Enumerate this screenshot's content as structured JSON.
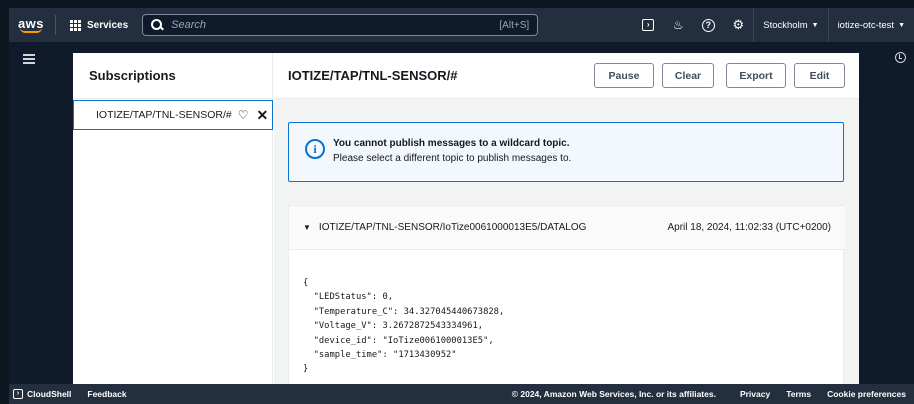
{
  "topnav": {
    "logo_text": "aws",
    "services_label": "Services",
    "search_placeholder": "Search",
    "search_shortcut": "[Alt+S]",
    "region": "Stockholm",
    "account": "iotize-otc-test"
  },
  "subscriptions": {
    "title": "Subscriptions",
    "items": [
      {
        "topic": "IOTIZE/TAP/TNL-SENSOR/#"
      }
    ]
  },
  "topic_panel": {
    "title": "IOTIZE/TAP/TNL-SENSOR/#",
    "buttons": {
      "pause": "Pause",
      "clear": "Clear",
      "export": "Export",
      "edit": "Edit"
    }
  },
  "alert": {
    "title": "You cannot publish messages to a wildcard topic.",
    "body": "Please select a different topic to publish messages to."
  },
  "message": {
    "topic": "IOTIZE/TAP/TNL-SENSOR/IoTize0061000013E5/DATALOG",
    "timestamp": "April 18, 2024, 11:02:33 (UTC+0200)",
    "payload_lines": [
      "{",
      "  \"LEDStatus\": 0,",
      "  \"Temperature_C\": 34.327045440673828,",
      "  \"Voltage_V\": 3.2672872543334961,",
      "  \"device_id\": \"IoTize0061000013E5\",",
      "  \"sample_time\": \"1713430952\"",
      "}"
    ]
  },
  "footer": {
    "cloudshell": "CloudShell",
    "feedback": "Feedback",
    "copyright": "© 2024, Amazon Web Services, Inc. or its affiliates.",
    "privacy": "Privacy",
    "terms": "Terms",
    "cookie": "Cookie preferences"
  },
  "colors": {
    "nav_bg": "#232f3e",
    "accent_blue": "#0972d3",
    "aws_orange": "#ff9900"
  }
}
